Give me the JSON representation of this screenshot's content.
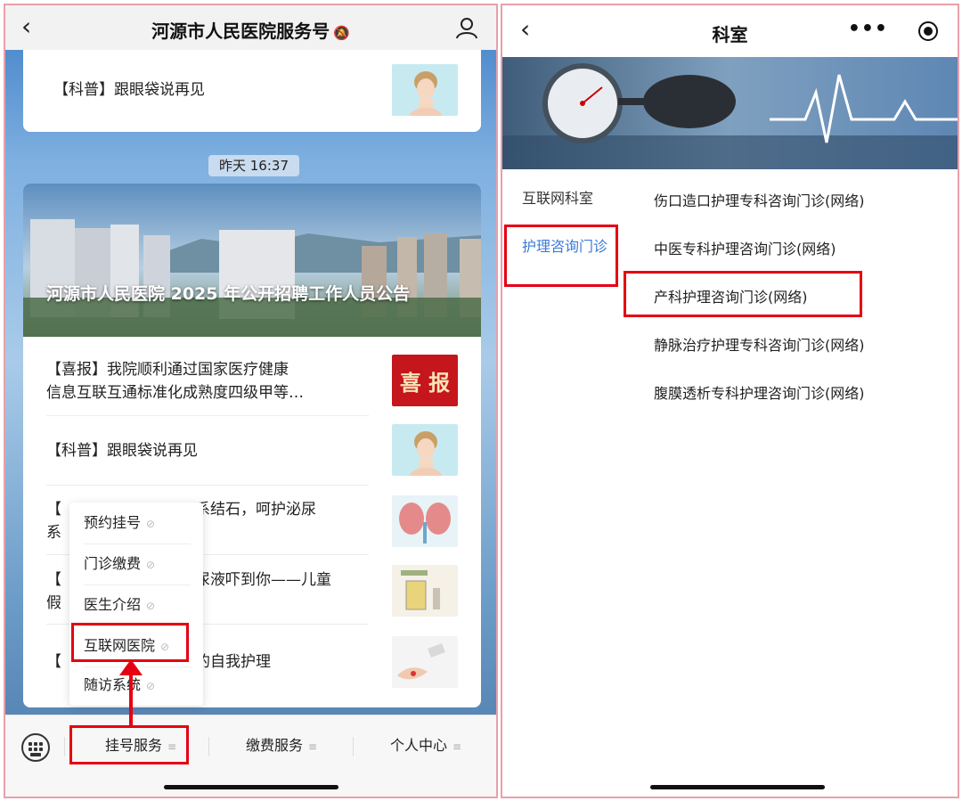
{
  "left": {
    "header": {
      "back_icon": "chevron-left-icon",
      "title": "河源市人民医院服务号",
      "mute_icon": "bell-off-icon",
      "profile_icon": "user-icon"
    },
    "top_article": {
      "title": "【科普】跟眼袋说再见"
    },
    "timestamp": "昨天 16:37",
    "hero": {
      "title": "河源市人民医院 2025 年公开招聘工作人员公告"
    },
    "articles": [
      {
        "line1": "【喜报】我院顺利通过国家医疗健康",
        "line2": "信息互联互通标准化成熟度四级甲等…",
        "thumb_text": "喜 报"
      },
      {
        "line1": "【科普】跟眼袋说再见",
        "line2": ""
      },
      {
        "line1": "【",
        "line1b": "系结石，呵护泌尿",
        "line2": "系"
      },
      {
        "line1": "【",
        "line1b": "尿液吓到你——儿童",
        "line2": "假"
      },
      {
        "line1": "【",
        "line1b": "的自我护理",
        "line2": ""
      }
    ],
    "popup_menu": [
      {
        "label": "预约挂号"
      },
      {
        "label": "门诊缴费"
      },
      {
        "label": "医生介绍"
      },
      {
        "label": "互联网医院"
      },
      {
        "label": "随访系统"
      }
    ],
    "bottom_tabs": [
      {
        "label": "挂号服务"
      },
      {
        "label": "缴费服务"
      },
      {
        "label": "个人中心"
      }
    ]
  },
  "right": {
    "header": {
      "back_icon": "chevron-left-icon",
      "title": "科室",
      "more_icon": "more-dots-icon",
      "target_icon": "record-target-icon"
    },
    "categories": [
      {
        "label": "互联网科室"
      },
      {
        "label": "护理咨询门诊"
      }
    ],
    "departments": [
      {
        "label": "伤口造口护理专科咨询门诊(网络)"
      },
      {
        "label": "中医专科护理咨询门诊(网络)"
      },
      {
        "label": "产科护理咨询门诊(网络)"
      },
      {
        "label": "静脉治疗护理专科咨询门诊(网络)"
      },
      {
        "label": "腹膜透析专科护理咨询门诊(网络)"
      }
    ]
  },
  "colors": {
    "highlight": "#e60012",
    "active_blue": "#3b7bd9"
  }
}
